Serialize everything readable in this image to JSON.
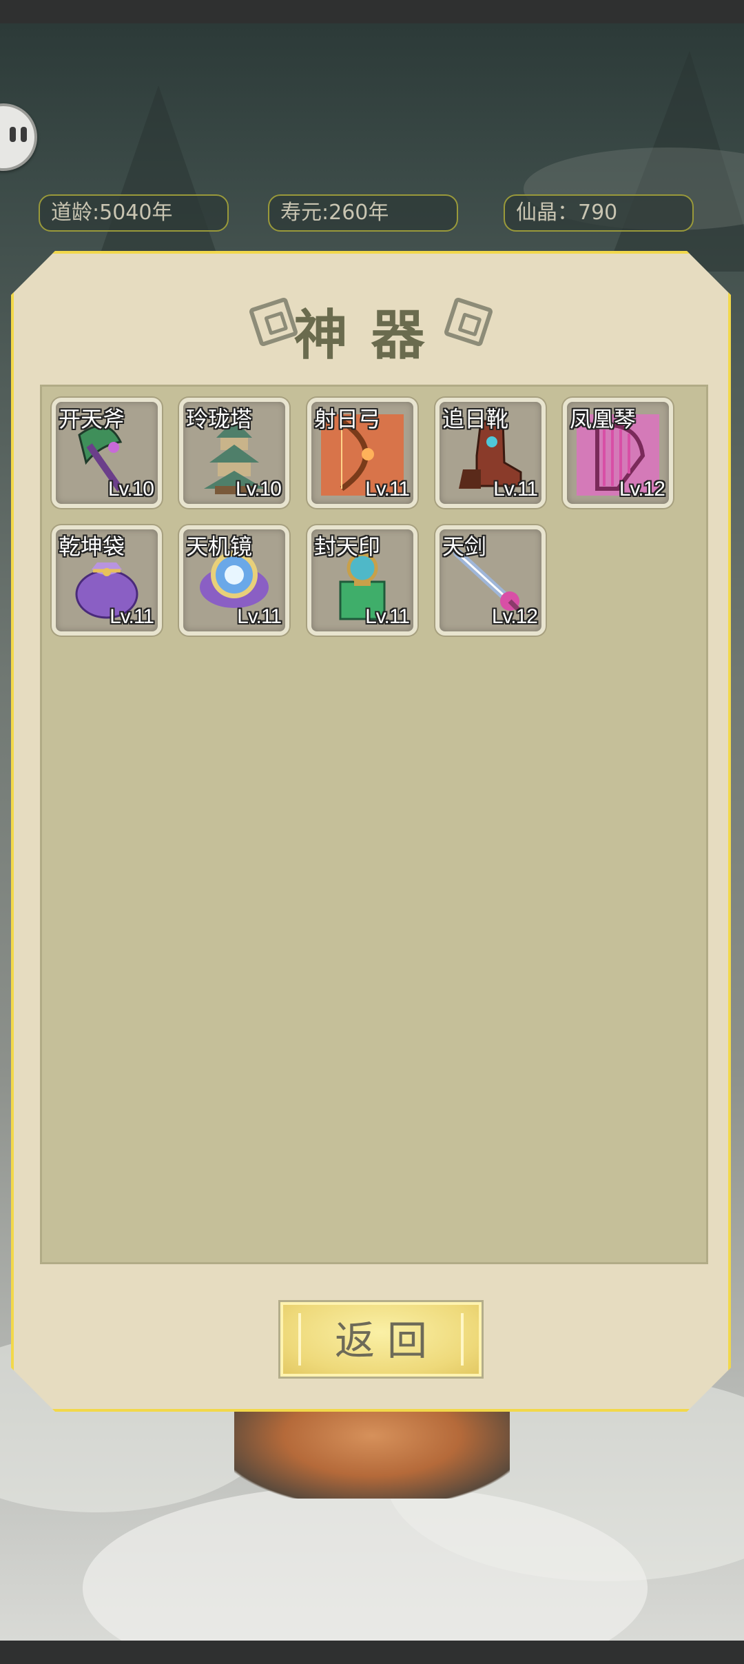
{
  "header": {
    "daoling": "道龄:5040年",
    "shouyuan": "寿元:260年",
    "xianjing": "仙晶：790"
  },
  "panel": {
    "title": "神器",
    "back_label": "返回"
  },
  "artifacts": [
    {
      "name": "开天斧",
      "level": "Lv.10",
      "icon": "axe-icon",
      "color": "#3f8f5a"
    },
    {
      "name": "玲珑塔",
      "level": "Lv.10",
      "icon": "pagoda-icon",
      "color": "#4f7f6a"
    },
    {
      "name": "射日弓",
      "level": "Lv.11",
      "icon": "bow-icon",
      "color": "#e07a3a"
    },
    {
      "name": "追日靴",
      "level": "Lv.11",
      "icon": "boots-icon",
      "color": "#8a3b2a"
    },
    {
      "name": "凤凰琴",
      "level": "Lv.12",
      "icon": "harp-icon",
      "color": "#d84fa6"
    },
    {
      "name": "乾坤袋",
      "level": "Lv.11",
      "icon": "bag-icon",
      "color": "#8a5fc4"
    },
    {
      "name": "天机镜",
      "level": "Lv.11",
      "icon": "mirror-icon",
      "color": "#6aa8e8"
    },
    {
      "name": "封天印",
      "level": "Lv.11",
      "icon": "seal-icon",
      "color": "#3fae6a"
    },
    {
      "name": "天剑",
      "level": "Lv.12",
      "icon": "sword-icon",
      "color": "#9fb6d8"
    }
  ]
}
